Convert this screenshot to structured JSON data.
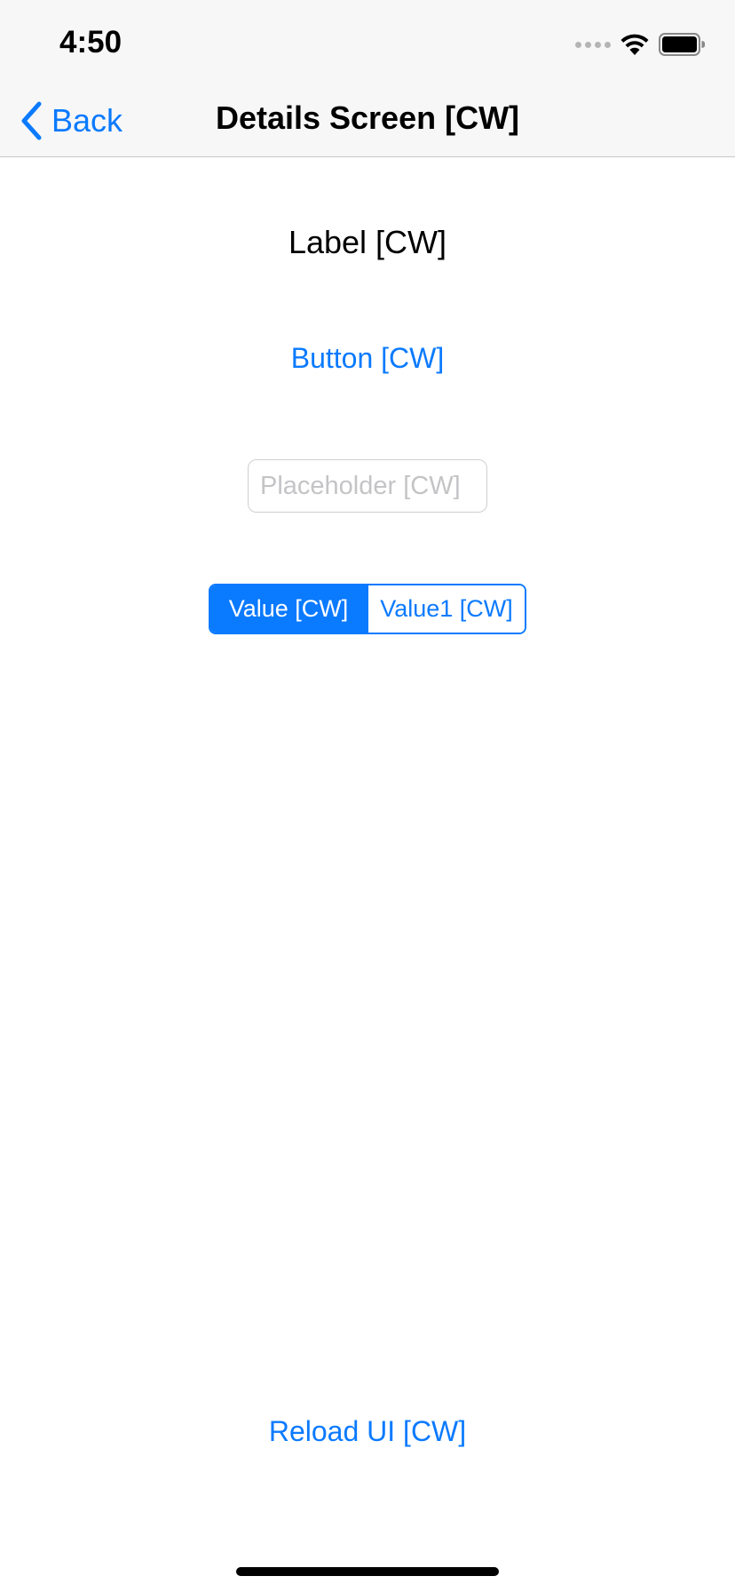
{
  "status_bar": {
    "time": "4:50",
    "icons": [
      "cellular-signal-icon",
      "wifi-icon",
      "battery-icon"
    ]
  },
  "nav": {
    "back_label": "Back",
    "back_icon": "chevron-left-icon",
    "title": "Details Screen [CW]"
  },
  "content": {
    "label": "Label [CW]",
    "button_label": "Button [CW]",
    "text_field": {
      "placeholder": "Placeholder [CW]",
      "value": ""
    },
    "segmented_control": {
      "segments": [
        "Value [CW]",
        "Value1 [CW]"
      ],
      "selected_index": 0
    },
    "reload_label": "Reload UI [CW]"
  },
  "colors": {
    "accent": "#0a7aff",
    "nav_background": "#f7f7f7",
    "background": "#ffffff"
  }
}
